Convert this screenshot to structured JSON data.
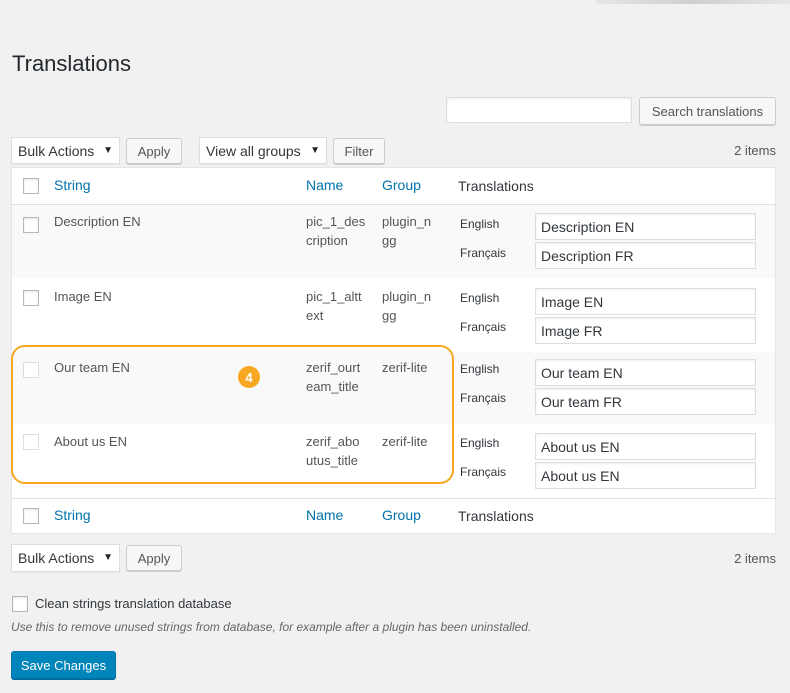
{
  "page": {
    "title": "Translations"
  },
  "search": {
    "placeholder": "",
    "button_label": "Search translations"
  },
  "top_nav": {
    "bulk_actions": "Bulk Actions",
    "apply": "Apply",
    "view_groups": "View all groups",
    "filter": "Filter",
    "items_count": "2 items"
  },
  "table": {
    "columns": {
      "string": "String",
      "name": "Name",
      "group": "Group",
      "translations": "Translations"
    },
    "rows": [
      {
        "string": "Description EN",
        "name": "pic_1_description",
        "group": "plugin_ngg",
        "translations": [
          {
            "lang": "English",
            "value": "Description EN"
          },
          {
            "lang": "Français",
            "value": "Description FR"
          }
        ]
      },
      {
        "string": "Image EN",
        "name": "pic_1_alttext",
        "group": "plugin_ngg",
        "translations": [
          {
            "lang": "English",
            "value": "Image EN"
          },
          {
            "lang": "Français",
            "value": "Image  FR"
          }
        ]
      },
      {
        "string": "Our team EN",
        "name": "zerif_ourteam_title",
        "group": "zerif-lite",
        "translations": [
          {
            "lang": "English",
            "value": "Our team EN"
          },
          {
            "lang": "Français",
            "value": "Our team FR"
          }
        ]
      },
      {
        "string": "About us EN",
        "name": "zerif_aboutus_title",
        "group": "zerif-lite",
        "translations": [
          {
            "lang": "English",
            "value": "About us EN"
          },
          {
            "lang": "Français",
            "value": "About us EN"
          }
        ]
      }
    ]
  },
  "bottom_nav": {
    "bulk_actions": "Bulk Actions",
    "apply": "Apply",
    "items_count": "2 items"
  },
  "callout": {
    "badge": "4",
    "color": "#f7a823"
  },
  "clean": {
    "label": "Clean strings translation database",
    "description": "Use this to remove unused strings from database, for example after a plugin has been uninstalled."
  },
  "save_button": "Save Changes",
  "colors": {
    "link": "#0073aa",
    "primary": "#0085ba"
  }
}
